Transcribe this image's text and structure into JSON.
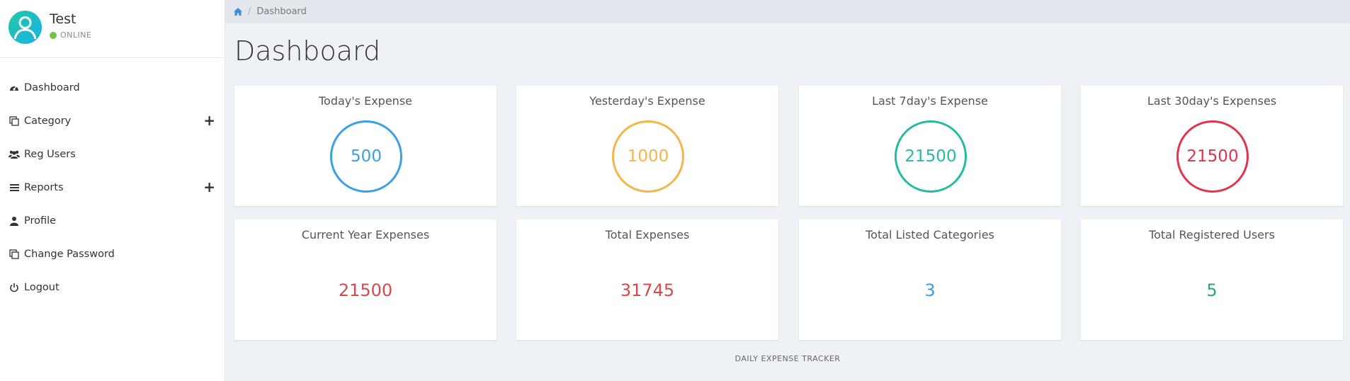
{
  "user": {
    "name": "Test",
    "status": "ONLINE"
  },
  "nav": {
    "items": [
      {
        "label": "Dashboard",
        "icon": "dashboard-icon",
        "expandable": false
      },
      {
        "label": "Category",
        "icon": "copy-icon",
        "expandable": true
      },
      {
        "label": "Reg Users",
        "icon": "users-icon",
        "expandable": false
      },
      {
        "label": "Reports",
        "icon": "list-icon",
        "expandable": true
      },
      {
        "label": "Profile",
        "icon": "user-icon",
        "expandable": false
      },
      {
        "label": "Change Password",
        "icon": "copy-icon",
        "expandable": false
      },
      {
        "label": "Logout",
        "icon": "power-icon",
        "expandable": false
      }
    ],
    "expand_symbol": "+"
  },
  "breadcrumb": {
    "separator": "/",
    "current": "Dashboard"
  },
  "page": {
    "title": "Dashboard"
  },
  "cards": [
    {
      "title": "Today's Expense",
      "value": "500",
      "color": "#3a9fe3",
      "style": "ring"
    },
    {
      "title": "Yesterday's Expense",
      "value": "1000",
      "color": "#f5b547",
      "style": "ring"
    },
    {
      "title": "Last 7day's Expense",
      "value": "21500",
      "color": "#26b9a6",
      "style": "ring"
    },
    {
      "title": "Last 30day's Expenses",
      "value": "21500",
      "color": "#e0344e",
      "style": "ring"
    },
    {
      "title": "Current Year Expenses",
      "value": "21500",
      "color": "#d9484c",
      "style": "plain"
    },
    {
      "title": "Total Expenses",
      "value": "31745",
      "color": "#d9484c",
      "style": "plain"
    },
    {
      "title": "Total Listed Categories",
      "value": "3",
      "color": "#3a9fe3",
      "style": "plain"
    },
    {
      "title": "Total Registered Users",
      "value": "5",
      "color": "#2aa876",
      "style": "plain"
    }
  ],
  "footer": {
    "text": "DAILY EXPENSE TRACKER"
  },
  "colors": {
    "accent": "#3b8fd9",
    "online": "#6cc644"
  }
}
